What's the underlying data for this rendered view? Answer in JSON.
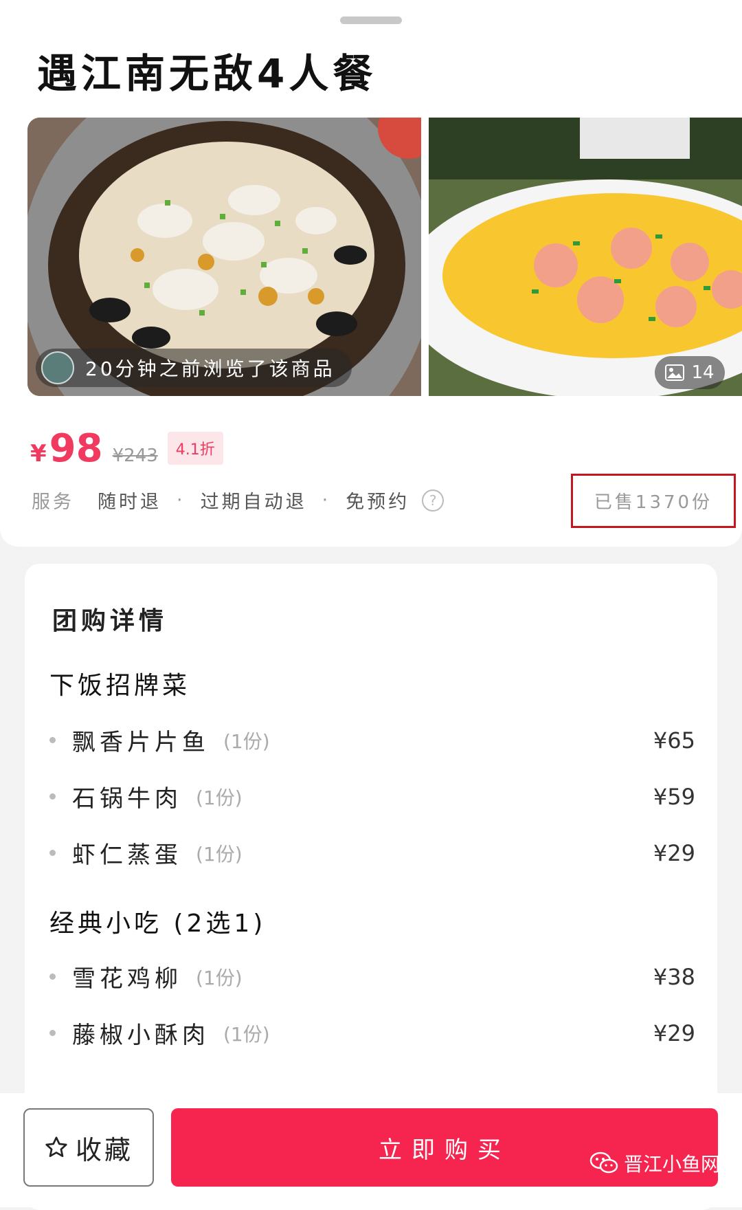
{
  "product": {
    "title": "遇江南无敌4人餐",
    "browse_text": "20分钟之前浏览了该商品",
    "image_count": "14",
    "price_symbol": "¥",
    "price": "98",
    "original_price": "¥243",
    "discount": "4.1折",
    "service_label": "服务",
    "services": [
      "随时退",
      "过期自动退",
      "免预约"
    ],
    "sold": "已售1370份"
  },
  "details": {
    "title": "团购详情",
    "groups": [
      {
        "name": "下饭招牌菜",
        "items": [
          {
            "name": "飘香片片鱼",
            "qty": "(1份)",
            "price": "¥65"
          },
          {
            "name": "石锅牛肉",
            "qty": "(1份)",
            "price": "¥59"
          },
          {
            "name": "虾仁蒸蛋",
            "qty": "(1份)",
            "price": "¥29"
          }
        ]
      },
      {
        "name": "经典小吃 (2选1)",
        "items": [
          {
            "name": "雪花鸡柳",
            "qty": "(1份)",
            "price": "¥38"
          },
          {
            "name": "藤椒小酥肉",
            "qty": "(1份)",
            "price": "¥29"
          }
        ]
      }
    ]
  },
  "bottom": {
    "favorite": "收藏",
    "buy": "立即购买",
    "watermark": "晋江小鱼网"
  },
  "colors": {
    "accent": "#f5254f",
    "price": "#f03a5f",
    "highlight_box": "#c4161c"
  },
  "icons": {
    "favorite": "star-outline-icon",
    "gallery": "image-icon",
    "help": "question-circle-icon",
    "watermark": "wechat-icon"
  }
}
